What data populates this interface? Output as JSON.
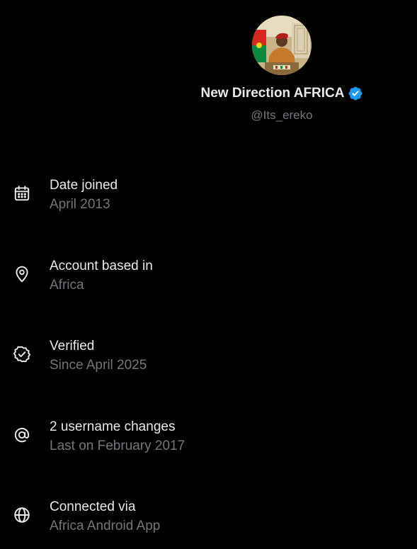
{
  "profile": {
    "display_name": "New Direction AFRICA",
    "handle": "@Its_ereko",
    "verified_badge_color": "#1d9bf0"
  },
  "info_items": [
    {
      "icon": "calendar-icon",
      "title": "Date joined",
      "subtitle": "April 2013"
    },
    {
      "icon": "location-pin-icon",
      "title": "Account based in",
      "subtitle": "Africa"
    },
    {
      "icon": "verified-seal-icon",
      "title": "Verified",
      "subtitle": "Since April 2025"
    },
    {
      "icon": "at-sign-icon",
      "title": "2 username changes",
      "subtitle": "Last on February 2017"
    },
    {
      "icon": "globe-icon",
      "title": "Connected via",
      "subtitle": "Africa Android App"
    }
  ],
  "colors": {
    "background": "#000000",
    "primary_text": "#e7e9ea",
    "secondary_text": "#71767b",
    "accent": "#1d9bf0"
  }
}
